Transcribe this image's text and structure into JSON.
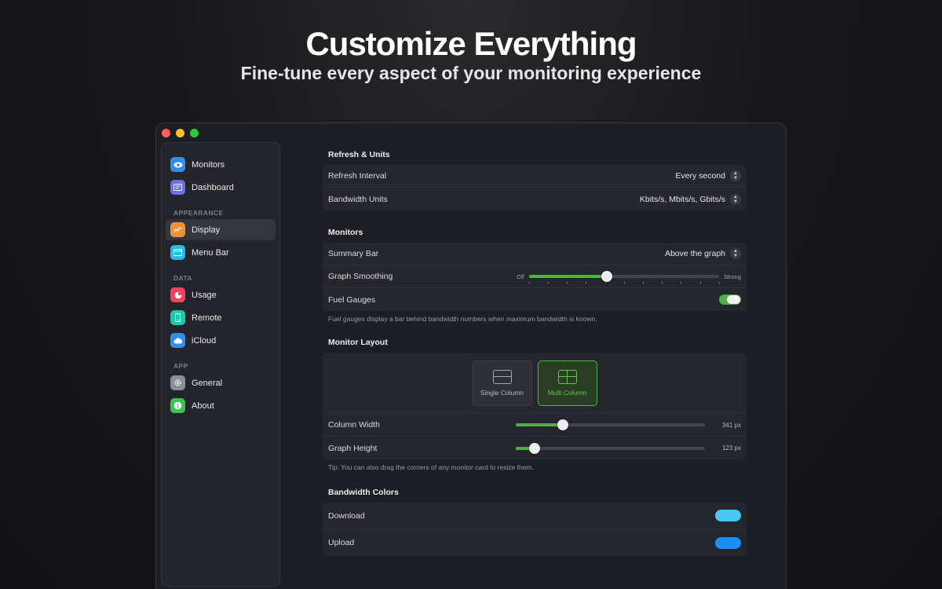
{
  "hero": {
    "title": "Customize Everything",
    "subtitle": "Fine-tune every aspect of your monitoring experience"
  },
  "sidebar": {
    "items_top": [
      {
        "label": "Monitors",
        "icon": "eye-icon",
        "color": "#2f8ff0"
      },
      {
        "label": "Dashboard",
        "icon": "dashboard-icon",
        "color": "#6d6ee8"
      }
    ],
    "appearance": {
      "section": "APPEARANCE",
      "items": [
        {
          "label": "Display",
          "icon": "chart-icon",
          "color": "#f0913a",
          "active": true
        },
        {
          "label": "Menu Bar",
          "icon": "menubar-icon",
          "color": "#2fb6e8"
        }
      ]
    },
    "data": {
      "section": "DATA",
      "items": [
        {
          "label": "Usage",
          "icon": "pie-icon",
          "color": "#f0445c"
        },
        {
          "label": "Remote",
          "icon": "phone-icon",
          "color": "#21c7a8"
        },
        {
          "label": "iCloud",
          "icon": "cloud-icon",
          "color": "#2f8ff0"
        }
      ]
    },
    "app": {
      "section": "APP",
      "items": [
        {
          "label": "General",
          "icon": "gear-icon",
          "color": "#8d8e94"
        },
        {
          "label": "About",
          "icon": "info-icon",
          "color": "#3ac34e"
        }
      ]
    }
  },
  "refresh": {
    "title": "Refresh & Units",
    "interval_label": "Refresh Interval",
    "interval_value": "Every second",
    "units_label": "Bandwidth Units",
    "units_value": "Kbits/s, Mbits/s, Gbits/s"
  },
  "monitors": {
    "title": "Monitors",
    "summary_label": "Summary Bar",
    "summary_value": "Above the graph",
    "smoothing_label": "Graph Smoothing",
    "smoothing_min": "Off",
    "smoothing_max": "Strong",
    "smoothing_level": 0.41,
    "fuel_label": "Fuel Gauges",
    "fuel_on": true,
    "note": "Fuel gauges display a bar behind bandwidth numbers when maximum bandwidth is known."
  },
  "layout": {
    "title": "Monitor Layout",
    "single": "Single Column",
    "multi": "Multi Column",
    "selected": "Multi Column",
    "column_width_label": "Column Width",
    "column_width_value": "341 px",
    "column_width_level": 0.25,
    "graph_height_label": "Graph Height",
    "graph_height_value": "123 px",
    "graph_height_level": 0.1,
    "tip": "Tip: You can also drag the corners of any monitor card to resize them."
  },
  "colors": {
    "title": "Bandwidth Colors",
    "download_label": "Download",
    "download_color": "#48c8f5",
    "upload_label": "Upload",
    "upload_color": "#1a8ff5"
  }
}
